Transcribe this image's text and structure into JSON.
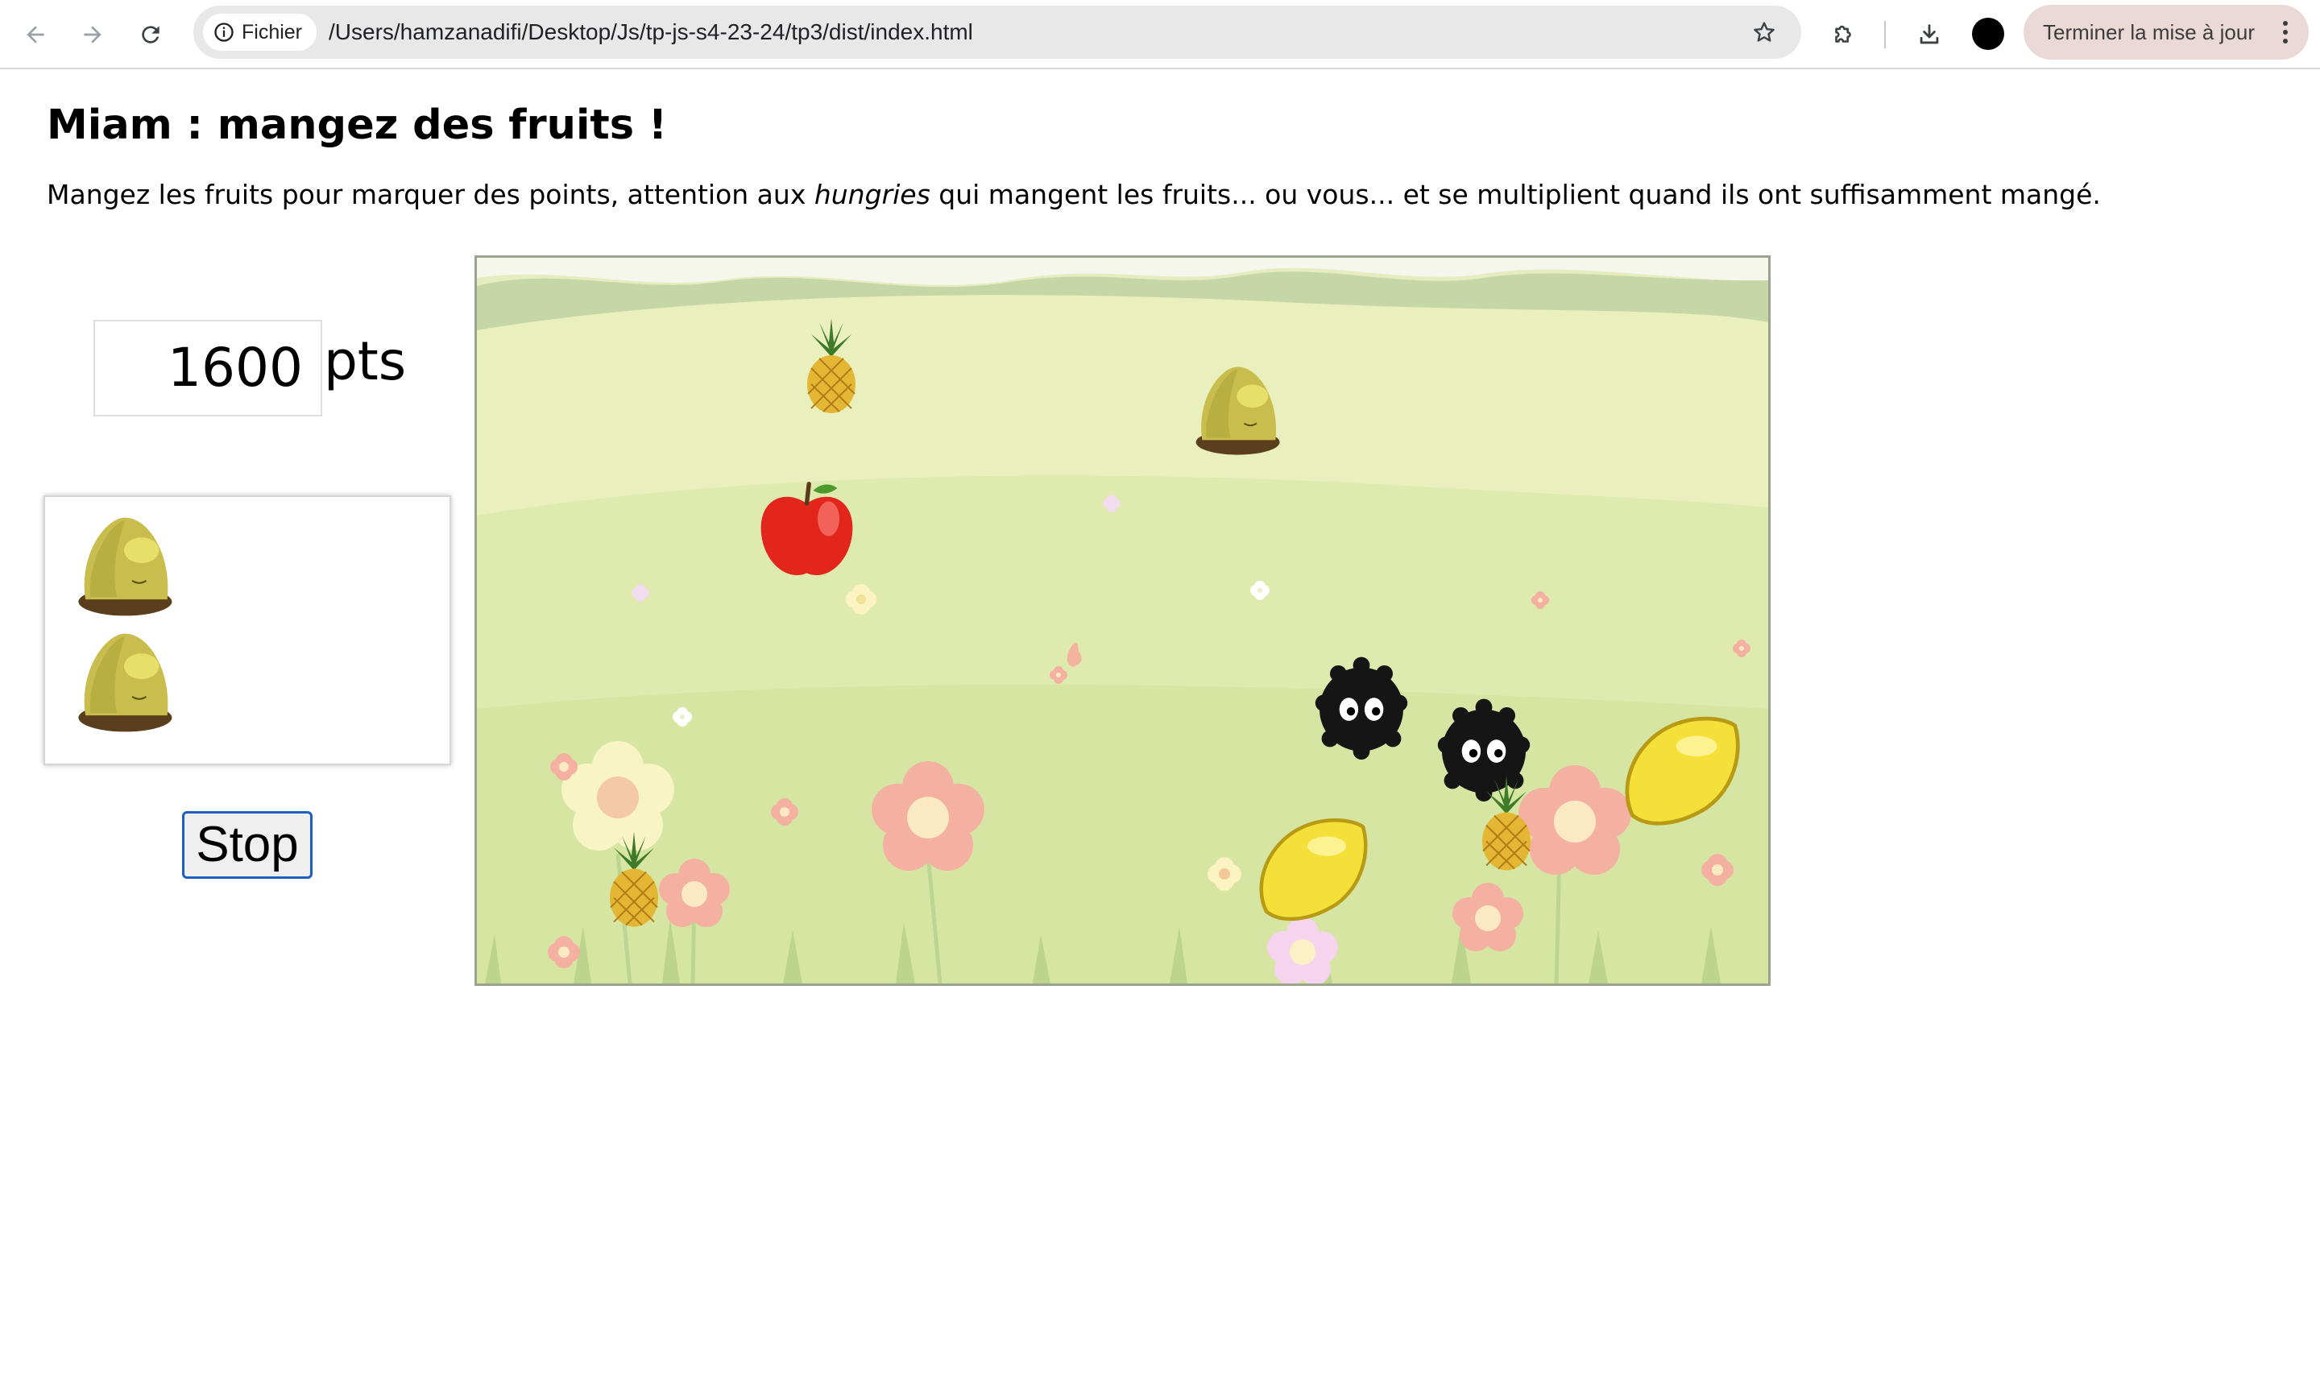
{
  "browser": {
    "security_chip": "Fichier",
    "url": "/Users/hamzanadifi/Desktop/Js/tp-js-s4-23-24/tp3/dist/index.html",
    "update_button": "Terminer la mise à jour",
    "icons": [
      "back-arrow-icon",
      "forward-arrow-icon",
      "reload-icon",
      "info-icon",
      "bookmark-star-icon",
      "extensions-puzzle-icon",
      "download-icon",
      "profile-avatar-icon",
      "more-vert-icon"
    ]
  },
  "page": {
    "title": "Miam : mangez des fruits !",
    "description_before": "Mangez les fruits pour marquer des points, attention aux ",
    "description_em": "hungries",
    "description_after": " qui mangent les fruits... ou vous... et se multiplient quand ils ont suffisamment mangé."
  },
  "scoreboard": {
    "score": "1600",
    "unit": "pts"
  },
  "lives": {
    "count": 2
  },
  "controls": {
    "stop_label": "Stop"
  },
  "game": {
    "sprites": [
      "pineapple",
      "player",
      "apple",
      "hungry",
      "hungry",
      "lemon",
      "pineapple",
      "lemon",
      "pineapple"
    ],
    "colors": {
      "sky": "#f3f7df",
      "hills": "#d9e8b0",
      "grass": "#cfe0a0",
      "flower_pink": "#f2a79a",
      "hungry": "#151515",
      "lemon": "#f5e03a",
      "apple": "#e2261c"
    }
  }
}
